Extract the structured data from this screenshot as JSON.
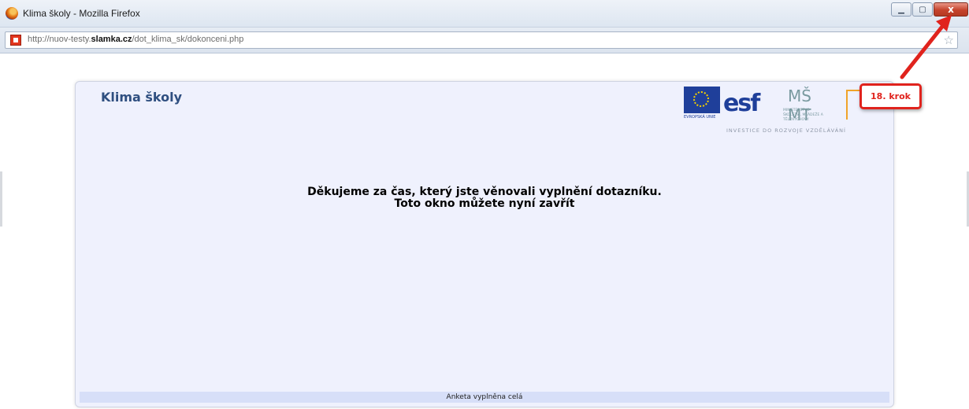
{
  "window": {
    "title": "Klima školy - Mozilla Firefox",
    "controls": {
      "minimize": "▁",
      "maximize": "▢",
      "close": "x"
    }
  },
  "address_bar": {
    "url_prefix": "http://nuov-testy.",
    "url_domain": "slamka.cz",
    "url_path": "/dot_klima_sk/dokonceni.php",
    "bookmark_star": "☆"
  },
  "page": {
    "title": "Klima školy",
    "logos": {
      "eu_caption": "EVROPSKÁ UNIE",
      "esf": "esf",
      "msmt_mark": "MŠ MT",
      "msmt_caption": "MINISTERSTVO ŠKOLSTVÍ, MLÁDEŽE A TĚLOVÝCHOVY",
      "tagline": "INVESTICE DO ROZVOJE VZDĚLÁVÁNÍ"
    },
    "message_line1": "Děkujeme za čas, který jste věnovali vyplnění dotazníku.",
    "message_line2": "Toto okno můžete nyní zavřít",
    "footer": "Anketa vyplněna celá"
  },
  "annotation": {
    "step_label": "18. krok",
    "color": "#e0231d"
  }
}
